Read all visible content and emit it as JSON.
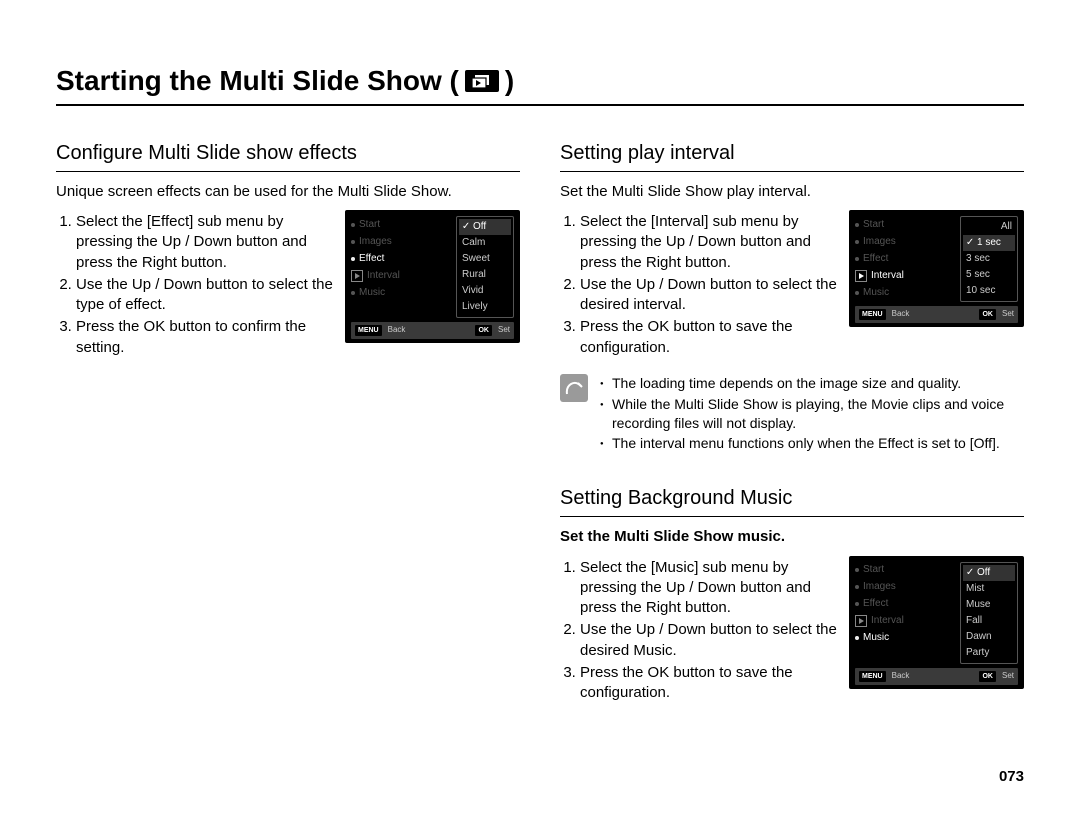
{
  "page_number": "073",
  "title": {
    "prefix": "Starting the Multi Slide Show (",
    "suffix": " )"
  },
  "sections": {
    "effects": {
      "heading": "Configure Multi Slide show effects",
      "intro": "Unique screen effects can be used for the Multi Slide Show.",
      "steps": [
        "Select the [Effect] sub menu by pressing the Up / Down button and press the Right button.",
        "Use the Up / Down button to select the type of effect.",
        "Press the OK button to confirm the setting."
      ],
      "menu": {
        "left": [
          "Start",
          "Images",
          "Effect",
          "Interval",
          "Music"
        ],
        "active": "Effect",
        "right": [
          "Off",
          "Calm",
          "Sweet",
          "Rural",
          "Vivid",
          "Lively"
        ],
        "selected": "Off"
      },
      "bar": {
        "back": "Back",
        "set": "Set",
        "menu": "MENU",
        "ok": "OK"
      }
    },
    "interval": {
      "heading": "Setting play interval",
      "intro": "Set the Multi Slide Show play interval.",
      "steps": [
        "Select the [Interval] sub menu by pressing the Up / Down button and press the Right button.",
        "Use the Up / Down button to select the desired interval.",
        "Press the OK button to save the configuration."
      ],
      "menu": {
        "left": [
          "Start",
          "Images",
          "Effect",
          "Interval",
          "Music"
        ],
        "active": "Interval",
        "right_label_all": "All",
        "right": [
          "1 sec",
          "3 sec",
          "5 sec",
          "10 sec"
        ],
        "selected": "1 sec"
      },
      "bar": {
        "back": "Back",
        "set": "Set",
        "menu": "MENU",
        "ok": "OK"
      }
    },
    "notes": [
      "The loading time depends on the image size and quality.",
      "While the Multi Slide Show is playing, the Movie clips and voice recording files will not display.",
      "The interval menu functions only when the Effect is set to [Off]."
    ],
    "music": {
      "heading": "Setting Background Music",
      "intro": "Set the Multi Slide Show music.",
      "steps": [
        "Select the [Music] sub menu by pressing the Up / Down button and press the Right button.",
        "Use the Up / Down button to select the desired Music.",
        "Press the OK button to save the configuration."
      ],
      "menu": {
        "left": [
          "Start",
          "Images",
          "Effect",
          "Interval",
          "Music"
        ],
        "active": "Music",
        "right": [
          "Off",
          "Mist",
          "Muse",
          "Fall",
          "Dawn",
          "Party"
        ],
        "selected": "Off"
      },
      "bar": {
        "back": "Back",
        "set": "Set",
        "menu": "MENU",
        "ok": "OK"
      }
    }
  }
}
